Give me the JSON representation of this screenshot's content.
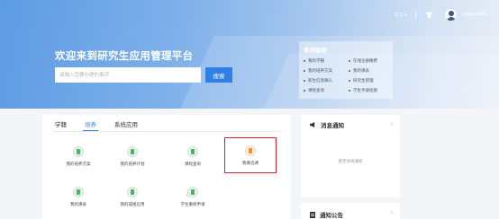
{
  "header": {
    "language": "中文",
    "username": "rijfuguan001",
    "welcome_title": "欢迎来到研究生应用管理平台",
    "search": {
      "placeholder": "请输入您要办理的事项",
      "button_label": "搜索"
    }
  },
  "common_services": {
    "title": "常用服务",
    "items": [
      "我的学籍",
      "我的培养方案",
      "新生信息确认",
      "课程查询",
      "在线注册缴费",
      "我的课表",
      "研究生管理",
      "学生手册指南"
    ]
  },
  "tabs": [
    "学籍",
    "培养",
    "系统应用"
  ],
  "active_tab": "培养",
  "tiles": [
    "我的培养方案",
    "我的培养计划",
    "课程查询",
    "我要选课",
    "我的课表",
    "我的成绩应用",
    "学生重修申请"
  ],
  "highlighted_tile": "我要选课",
  "notices": {
    "title": "消息通知",
    "empty_text": "暂无待阅通知"
  },
  "announcements": {
    "title": "通知公告"
  },
  "colors": {
    "accent": "#2f7fe6",
    "highlight_border": "#d9222a",
    "tile_icon_green": "#4caf6a",
    "tile_icon_orange": "#ef8f33"
  }
}
